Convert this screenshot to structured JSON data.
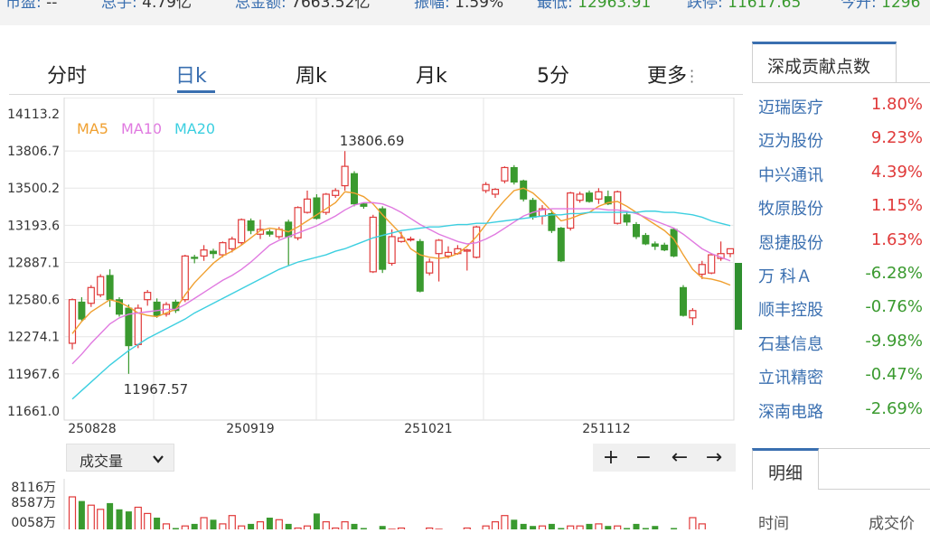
{
  "top_stats": [
    {
      "label": "市盈:",
      "value": "--"
    },
    {
      "label": "总手:",
      "value": "4.79亿"
    },
    {
      "label": "总金额:",
      "value": "7663.52亿"
    },
    {
      "label": "振幅:",
      "value": "1.59%"
    },
    {
      "label": "最低:",
      "value": "12963.91"
    },
    {
      "label": "跌停:",
      "value": "11617.65"
    },
    {
      "label": "today_open_label",
      "value": "今开:"
    },
    {
      "label": "today_open_value",
      "value": "1296"
    }
  ],
  "tabs": [
    "分时",
    "日k",
    "周k",
    "月k",
    "5分",
    "更多"
  ],
  "active_tab": "日k",
  "ma_legend": [
    {
      "name": "MA5",
      "color": "#f0a030"
    },
    {
      "name": "MA10",
      "color": "#e07ae0"
    },
    {
      "name": "MA20",
      "color": "#3ccfe0"
    }
  ],
  "chart_data": {
    "type": "candlestick",
    "y_ticks": [
      "14113.2",
      "13806.7",
      "13500.2",
      "13193.6",
      "12887.1",
      "12580.6",
      "12274.1",
      "11967.6",
      "11661.0"
    ],
    "ylim": [
      11661.0,
      14113.2
    ],
    "x_ticks": [
      "250828",
      "250919",
      "251021",
      "251112"
    ],
    "annotations": {
      "high": "13806.69",
      "low": "11967.57"
    },
    "candles": [
      [
        12220,
        12580,
        12170,
        12590
      ],
      [
        12560,
        12420,
        12400,
        12600
      ],
      [
        12550,
        12680,
        12520,
        12700
      ],
      [
        12620,
        12770,
        12600,
        12790
      ],
      [
        12780,
        12580,
        12520,
        12830
      ],
      [
        12580,
        12460,
        12440,
        12600
      ],
      [
        12510,
        12200,
        11968,
        12540
      ],
      [
        12210,
        12510,
        12180,
        12540
      ],
      [
        12580,
        12640,
        12530,
        12660
      ],
      [
        12560,
        12450,
        12430,
        12590
      ],
      [
        12460,
        12540,
        12440,
        12560
      ],
      [
        12560,
        12490,
        12470,
        12580
      ],
      [
        12580,
        12940,
        12560,
        12950
      ],
      [
        12930,
        12920,
        12880,
        12950
      ],
      [
        12940,
        12990,
        12900,
        13030
      ],
      [
        12980,
        12960,
        12920,
        13000
      ],
      [
        12950,
        13050,
        12930,
        13060
      ],
      [
        13000,
        13080,
        12970,
        13100
      ],
      [
        13050,
        13240,
        13030,
        13250
      ],
      [
        13230,
        13150,
        13120,
        13250
      ],
      [
        13120,
        13160,
        13080,
        13240
      ],
      [
        13140,
        13120,
        13100,
        13160
      ],
      [
        13100,
        13160,
        13080,
        13180
      ],
      [
        13220,
        13100,
        12860,
        13240
      ],
      [
        13090,
        13340,
        13070,
        13350
      ],
      [
        13300,
        13410,
        13290,
        13480
      ],
      [
        13420,
        13250,
        13240,
        13450
      ],
      [
        13300,
        13450,
        13280,
        13460
      ],
      [
        13440,
        13480,
        13420,
        13500
      ],
      [
        13520,
        13680,
        13480,
        13806
      ],
      [
        13620,
        13370,
        13350,
        13640
      ],
      [
        13370,
        13350,
        13330,
        13380
      ],
      [
        12810,
        13260,
        12800,
        13280
      ],
      [
        13330,
        12830,
        12800,
        13350
      ],
      [
        12880,
        13100,
        12860,
        13160
      ],
      [
        13060,
        13090,
        13050,
        13140
      ],
      [
        13080,
        13080,
        13060,
        13100
      ],
      [
        13060,
        12650,
        12640,
        13080
      ],
      [
        12800,
        12890,
        12780,
        12920
      ],
      [
        12960,
        13070,
        12730,
        13080
      ],
      [
        12940,
        12970,
        12920,
        13020
      ],
      [
        12960,
        13000,
        12950,
        13030
      ],
      [
        12980,
        12990,
        12820,
        13000
      ],
      [
        12930,
        13180,
        12920,
        13190
      ],
      [
        13480,
        13530,
        13460,
        13550
      ],
      [
        13450,
        13490,
        13420,
        13500
      ],
      [
        13560,
        13670,
        13540,
        13680
      ],
      [
        13670,
        13550,
        13530,
        13690
      ],
      [
        13560,
        13410,
        13390,
        13570
      ],
      [
        13400,
        13260,
        13240,
        13420
      ],
      [
        13270,
        13330,
        13200,
        13360
      ],
      [
        13290,
        13150,
        13130,
        13320
      ],
      [
        13170,
        12900,
        12890,
        13180
      ],
      [
        13170,
        13460,
        13150,
        13470
      ],
      [
        13400,
        13450,
        13380,
        13470
      ],
      [
        13460,
        13390,
        13380,
        13480
      ],
      [
        13410,
        13470,
        13370,
        13500
      ],
      [
        13430,
        13370,
        13360,
        13480
      ],
      [
        13210,
        13470,
        13200,
        13480
      ],
      [
        13280,
        13220,
        13190,
        13300
      ],
      [
        13200,
        13100,
        13080,
        13220
      ],
      [
        13110,
        13040,
        13030,
        13130
      ],
      [
        13040,
        13020,
        12990,
        13060
      ],
      [
        13030,
        12990,
        12980,
        13050
      ],
      [
        13160,
        12940,
        12930,
        13170
      ],
      [
        12680,
        12450,
        12440,
        12700
      ],
      [
        12430,
        12490,
        12370,
        12510
      ],
      [
        12790,
        12870,
        12750,
        12900
      ],
      [
        12800,
        12950,
        12790,
        12960
      ],
      [
        12920,
        12960,
        12900,
        13060
      ],
      [
        12960,
        13000,
        12930,
        13000
      ]
    ],
    "ma5": [
      12300,
      12400,
      12480,
      12530,
      12580,
      12560,
      12520,
      12470,
      12450,
      12440,
      12470,
      12500,
      12620,
      12720,
      12800,
      12880,
      12940,
      12980,
      13030,
      13090,
      13150,
      13170,
      13160,
      13140,
      13180,
      13230,
      13280,
      13330,
      13380,
      13470,
      13460,
      13430,
      13370,
      13280,
      13200,
      13120,
      13000,
      12950,
      12930,
      12920,
      12930,
      12960,
      13020,
      13100,
      13200,
      13310,
      13400,
      13480,
      13500,
      13460,
      13390,
      13310,
      13230,
      13250,
      13280,
      13300,
      13350,
      13380,
      13390,
      13350,
      13300,
      13250,
      13200,
      13150,
      13080,
      12950,
      12830,
      12760,
      12750,
      12730,
      12700
    ],
    "ma10": [
      12050,
      12130,
      12220,
      12300,
      12380,
      12430,
      12460,
      12470,
      12480,
      12490,
      12500,
      12500,
      12540,
      12590,
      12640,
      12690,
      12740,
      12780,
      12830,
      12890,
      12960,
      13030,
      13070,
      13100,
      13130,
      13160,
      13190,
      13230,
      13270,
      13320,
      13360,
      13380,
      13380,
      13370,
      13340,
      13300,
      13250,
      13200,
      13160,
      13120,
      13090,
      13060,
      13040,
      13050,
      13080,
      13120,
      13170,
      13220,
      13270,
      13300,
      13320,
      13330,
      13330,
      13330,
      13330,
      13330,
      13330,
      13320,
      13320,
      13310,
      13290,
      13260,
      13230,
      13200,
      13170,
      13120,
      13060,
      13000,
      12960,
      12930,
      12900
    ],
    "ma20": [
      11760,
      11830,
      11900,
      11970,
      12040,
      12100,
      12160,
      12210,
      12260,
      12300,
      12340,
      12380,
      12420,
      12470,
      12510,
      12550,
      12590,
      12630,
      12670,
      12710,
      12750,
      12790,
      12830,
      12860,
      12890,
      12910,
      12930,
      12950,
      12980,
      13000,
      13030,
      13060,
      13090,
      13110,
      13130,
      13150,
      13160,
      13170,
      13180,
      13180,
      13190,
      13200,
      13200,
      13210,
      13210,
      13220,
      13230,
      13240,
      13250,
      13260,
      13270,
      13280,
      13280,
      13290,
      13290,
      13300,
      13300,
      13300,
      13300,
      13300,
      13300,
      13310,
      13310,
      13300,
      13300,
      13290,
      13280,
      13260,
      13230,
      13210,
      13190
    ]
  },
  "volume": {
    "select_label": "成交量",
    "y_ticks": [
      "8116万",
      "8587万",
      "0058万"
    ],
    "bars": [
      1,
      0.9,
      0.8,
      0.7,
      0.85,
      0.7,
      0.65,
      0.75,
      0.6,
      0.5,
      0.35,
      0.25,
      0.3,
      0.35,
      0.5,
      0.45,
      0.35,
      0.55,
      0.3,
      0.35,
      0.4,
      0.5,
      0.45,
      0.35,
      0.25,
      0.3,
      0.6,
      0.4,
      0.25,
      0.4,
      0.35,
      0.25,
      0.2,
      0.3,
      0.22,
      0.25,
      0.2,
      0.2,
      0.25,
      0.22,
      0.2,
      0.2,
      0.25,
      0.2,
      0.3,
      0.4,
      0.55,
      0.45,
      0.35,
      0.3,
      0.3,
      0.35,
      0.25,
      0.3,
      0.3,
      0.35,
      0.35,
      0.3,
      0.3,
      0.25,
      0.35,
      0.25,
      0.3,
      0.2,
      0.25,
      0.2,
      0.5,
      0.35,
      0.2,
      0.2,
      0.2
    ]
  },
  "zoom_controls": [
    "+",
    "−",
    "←",
    "→"
  ],
  "side_panel": {
    "tab": "深成贡献点数",
    "stocks": [
      {
        "name": "迈瑞医疗",
        "pct": "1.80%",
        "dir": "up"
      },
      {
        "name": "迈为股份",
        "pct": "9.23%",
        "dir": "up"
      },
      {
        "name": "中兴通讯",
        "pct": "4.39%",
        "dir": "up"
      },
      {
        "name": "牧原股份",
        "pct": "1.15%",
        "dir": "up"
      },
      {
        "name": "恩捷股份",
        "pct": "1.63%",
        "dir": "up"
      },
      {
        "name": "万 科Ａ",
        "pct": "-6.28%",
        "dir": "down"
      },
      {
        "name": "顺丰控股",
        "pct": "-0.76%",
        "dir": "down"
      },
      {
        "name": "石基信息",
        "pct": "-9.98%",
        "dir": "down"
      },
      {
        "name": "立讯精密",
        "pct": "-0.47%",
        "dir": "down"
      },
      {
        "name": "深南电路",
        "pct": "-2.69%",
        "dir": "down"
      }
    ]
  },
  "detail": {
    "tab": "明细",
    "col_time": "时间",
    "col_price": "成交价"
  },
  "colors": {
    "up": "#e03a3a",
    "down": "#3a9a2f",
    "accent": "#3a6fb0"
  }
}
